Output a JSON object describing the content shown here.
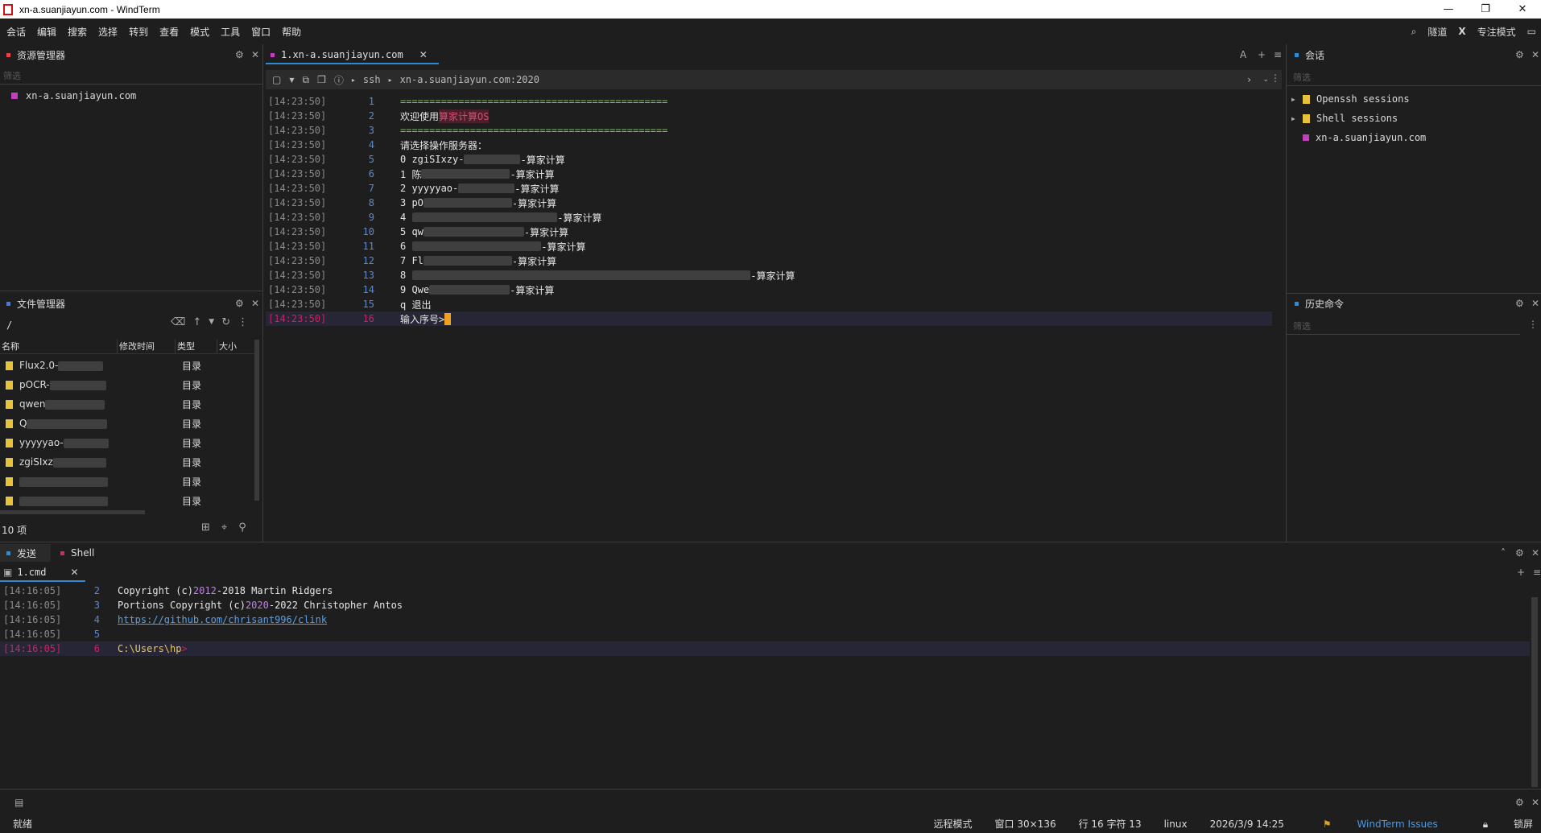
{
  "window": {
    "title": "xn-a.suanjiayun.com - WindTerm",
    "min": "—",
    "restore": "❐",
    "close": "✕"
  },
  "menu": [
    "会话",
    "编辑",
    "搜索",
    "选择",
    "转到",
    "查看",
    "模式",
    "工具",
    "窗口",
    "帮助"
  ],
  "menu_right": {
    "search": "⌕",
    "tunnel": "隧道",
    "x": "X",
    "focus": "专注模式",
    "layout": "▭"
  },
  "left": {
    "resource_title": "资源管理器",
    "filter_placeholder": "筛选",
    "host": "xn-a.suanjiayun.com",
    "file_title": "文件管理器",
    "path": "/",
    "headers": {
      "name": "名称",
      "mtime": "修改时间",
      "type": "类型",
      "size": "大小"
    },
    "rows": [
      {
        "name": "Flux2.0-",
        "type": "目录"
      },
      {
        "name": "pOCR-",
        "type": "目录"
      },
      {
        "name": "qwen",
        "type": "目录"
      },
      {
        "name": "Q",
        "type": "目录"
      },
      {
        "name": "yyyyyao-",
        "type": "目录"
      },
      {
        "name": "zgiSIxz",
        "type": "目录"
      },
      {
        "name": "",
        "type": "目录"
      },
      {
        "name": "",
        "type": "目录"
      }
    ],
    "count": "10 项"
  },
  "terminal": {
    "tab": "1.xn-a.suanjiayun.com",
    "proto": "ssh",
    "host": "xn-a.suanjiayun.com:2020",
    "lines": [
      {
        "ts": "[14:23:50]",
        "n": "1",
        "text": "=============================================="
      },
      {
        "ts": "[14:23:50]",
        "n": "2",
        "text": "欢迎使用",
        "hl": "算家计算OS"
      },
      {
        "ts": "[14:23:50]",
        "n": "3",
        "text": "=============================================="
      },
      {
        "ts": "[14:23:50]",
        "n": "4",
        "text": "请选择操作服务器："
      },
      {
        "ts": "[14:23:50]",
        "n": "5",
        "text": "0 zgiSIxzy-",
        "suffix": "-算家计算"
      },
      {
        "ts": "[14:23:50]",
        "n": "6",
        "text": "1 陈",
        "suffix": "-算家计算"
      },
      {
        "ts": "[14:23:50]",
        "n": "7",
        "text": "2 yyyyyao-",
        "suffix": "-算家计算"
      },
      {
        "ts": "[14:23:50]",
        "n": "8",
        "text": "3 pO",
        "suffix": "-算家计算"
      },
      {
        "ts": "[14:23:50]",
        "n": "9",
        "text": "4",
        "suffix": "-算家计算"
      },
      {
        "ts": "[14:23:50]",
        "n": "10",
        "text": "5 qw",
        "suffix": "-算家计算"
      },
      {
        "ts": "[14:23:50]",
        "n": "11",
        "text": "6",
        "suffix": "-算家计算"
      },
      {
        "ts": "[14:23:50]",
        "n": "12",
        "text": "7 Fl",
        "suffix": "-算家计算"
      },
      {
        "ts": "[14:23:50]",
        "n": "13",
        "text": "8",
        "suffix": "-算家计算"
      },
      {
        "ts": "[14:23:50]",
        "n": "14",
        "text": "9 Qwe",
        "suffix": "-算家计算"
      },
      {
        "ts": "[14:23:50]",
        "n": "15",
        "text": "q 退出"
      },
      {
        "ts": "[14:23:50]",
        "n": "16",
        "text": "输入序号>"
      }
    ]
  },
  "right": {
    "sessions_title": "会话",
    "filter_placeholder": "筛选",
    "items": [
      "Openssh sessions",
      "Shell sessions",
      "xn-a.suanjiayun.com"
    ],
    "history_title": "历史命令"
  },
  "bottom": {
    "tab_send": "发送",
    "tab_shell": "Shell",
    "cmd_tab": "1.cmd",
    "lines": [
      {
        "ts": "[14:16:05]",
        "n": "2",
        "a": "Copyright (c) ",
        "year": "2012",
        "b": "-2018 Martin Ridgers"
      },
      {
        "ts": "[14:16:05]",
        "n": "3",
        "a": "Portions Copyright (c) ",
        "year": "2020",
        "b": "-2022 Christopher Antos"
      },
      {
        "ts": "[14:16:05]",
        "n": "4",
        "link": "https://github.com/chrisant996/clink"
      },
      {
        "ts": "[14:16:05]",
        "n": "5"
      },
      {
        "ts": "[14:16:05]",
        "n": "6",
        "prompt": "C:\\Users\\hp",
        "gt": ">"
      }
    ]
  },
  "status": {
    "ready": "就绪",
    "mode": "远程模式",
    "window": "窗口 30×136",
    "pos": "行 16 字符 13",
    "os": "linux",
    "datetime": "2026/3/9 14:25",
    "issues": "WindTerm Issues",
    "lock": "锁屏"
  },
  "colors": {
    "accent": "#2f8ad6",
    "magenta": "#c040c0",
    "folder": "#e8c23a",
    "green": "#6ec84a",
    "cursor": "#f0a020"
  }
}
